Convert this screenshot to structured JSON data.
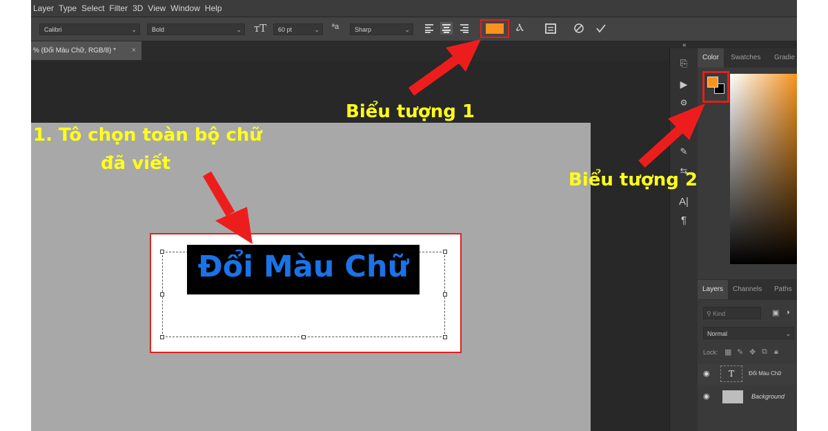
{
  "menu": [
    "Layer",
    "Type",
    "Select",
    "Filter",
    "3D",
    "View",
    "Window",
    "Help"
  ],
  "options": {
    "font_family": "Calibri",
    "font_style": "Bold",
    "font_size": "60 pt",
    "antialias": "Sharp",
    "text_color": "#f7931e"
  },
  "document_tab": {
    "title": "% (Đổi Màu Chữ, RGB/8) *",
    "close": "×"
  },
  "canvas": {
    "selected_text": "Đổi Màu Chữ",
    "text_color": "#1a73e8"
  },
  "annotations": {
    "icon1": "Biểu tượng 1",
    "icon2": "Biểu tượng 2",
    "step1_line1": "1. Tô chọn toàn bộ chữ",
    "step1_line2": "đã viết"
  },
  "panels": {
    "color_tabs": [
      "Color",
      "Swatches",
      "Gradie"
    ],
    "foreground_color": "#f7931e",
    "background_color": "#000000",
    "layers_tabs": [
      "Layers",
      "Channels",
      "Paths"
    ],
    "filter_placeholder": "Kind",
    "blend_mode": "Normal",
    "lock_label": "Lock:",
    "layers": [
      {
        "name": "Đổi Màu Chữ",
        "thumb": "T"
      },
      {
        "name": "Background"
      }
    ]
  }
}
